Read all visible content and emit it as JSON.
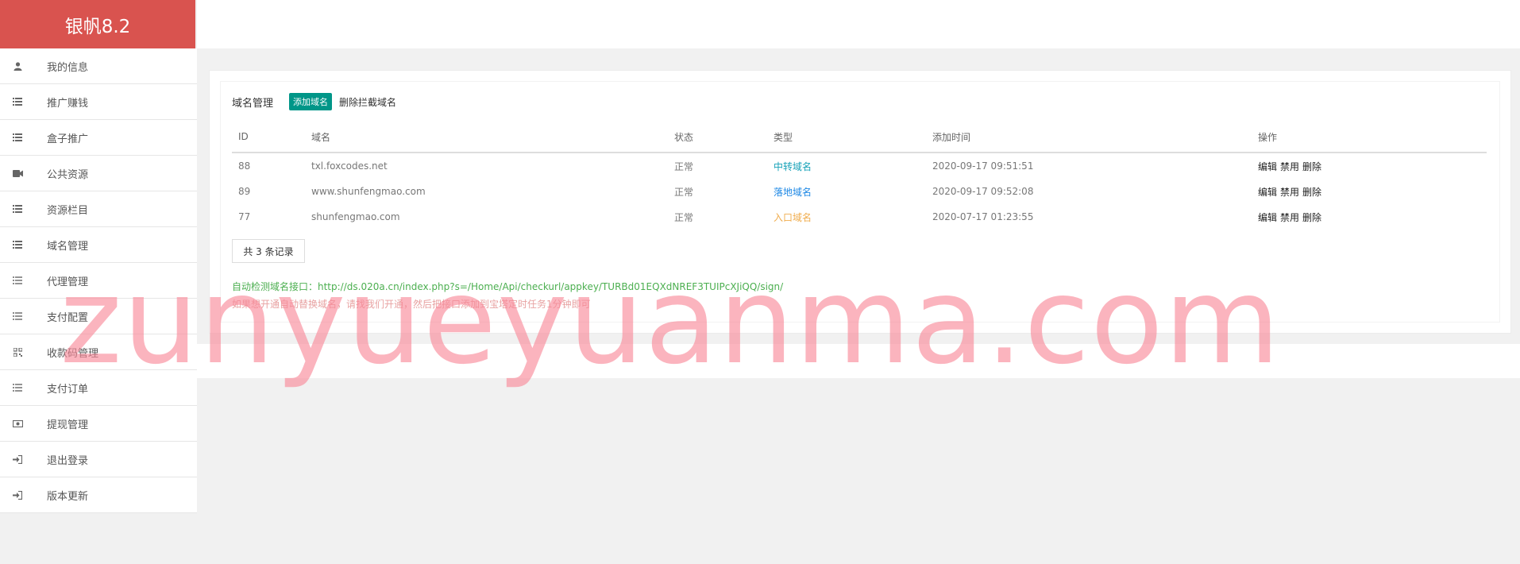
{
  "app": {
    "brand": "银帆8.2"
  },
  "sidebar": {
    "items": [
      {
        "label": "我的信息",
        "icon": "user-icon"
      },
      {
        "label": "推广赚钱",
        "icon": "list-icon"
      },
      {
        "label": "盒子推广",
        "icon": "list-icon"
      },
      {
        "label": "公共资源",
        "icon": "video-camera-icon"
      },
      {
        "label": "资源栏目",
        "icon": "list-icon"
      },
      {
        "label": "域名管理",
        "icon": "list-icon"
      },
      {
        "label": "代理管理",
        "icon": "list-ul-icon"
      },
      {
        "label": "支付配置",
        "icon": "list-ul-icon"
      },
      {
        "label": "收款码管理",
        "icon": "qrcode-icon"
      },
      {
        "label": "支付订单",
        "icon": "list-ul-icon"
      },
      {
        "label": "提现管理",
        "icon": "money-icon"
      },
      {
        "label": "退出登录",
        "icon": "sign-in-icon"
      },
      {
        "label": "版本更新",
        "icon": "sign-in-icon"
      }
    ]
  },
  "main": {
    "title": "域名管理",
    "add_button": "添加域名",
    "delete_link": "删除拦截域名",
    "table": {
      "headers": [
        "ID",
        "域名",
        "状态",
        "类型",
        "添加时间",
        "操作"
      ],
      "rows": [
        {
          "id": "88",
          "domain": "txl.foxcodes.net",
          "status": "正常",
          "type": "中转域名",
          "time": "2020-09-17 09:51:51",
          "ops": [
            "编辑",
            "禁用",
            "删除"
          ]
        },
        {
          "id": "89",
          "domain": "www.shunfengmao.com",
          "status": "正常",
          "type": "落地域名",
          "time": "2020-09-17 09:52:08",
          "ops": [
            "编辑",
            "禁用",
            "删除"
          ]
        },
        {
          "id": "77",
          "domain": "shunfengmao.com",
          "status": "正常",
          "type": "入口域名",
          "time": "2020-07-17 01:23:55",
          "ops": [
            "编辑",
            "禁用",
            "删除"
          ]
        }
      ]
    },
    "pager_text": "共 3 条记录",
    "note_api": "自动检测域名接口：http://ds.020a.cn/index.php?s=/Home/Api/checkurl/appkey/TURBd01EQXdNREF3TUIPcXJiQQ/sign/",
    "note_tip": "如果想开通自动替换域名，请找我们开通，然后把接口添加到宝塔定时任务1分钟即可"
  },
  "watermark": "zunyueyuanma.com",
  "colors": {
    "brand": "#d9534f",
    "add_button": "#009688",
    "type_transit": "#17a2b8",
    "type_landing": "#1e88e5",
    "type_entry": "#f0ad4e"
  }
}
